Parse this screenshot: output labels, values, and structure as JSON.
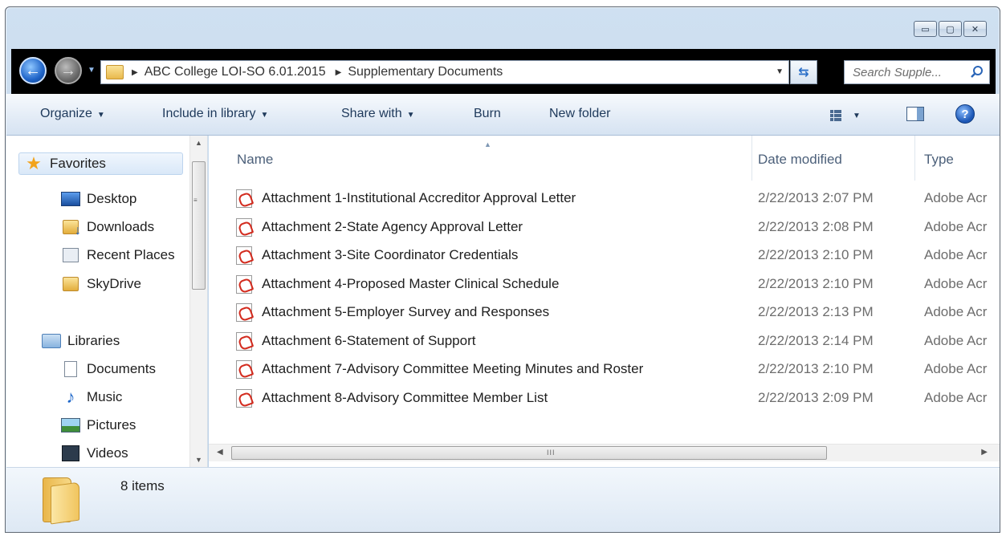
{
  "window": {
    "caption": {
      "minimize": "▭",
      "maximize": "▢",
      "close": "✕"
    }
  },
  "address": {
    "crumbs": [
      "ABC College LOI-SO 6.01.2015",
      "Supplementary Documents"
    ]
  },
  "search": {
    "placeholder": "Search Supple..."
  },
  "toolbar": {
    "organize": "Organize",
    "include_in_library": "Include in library",
    "share_with": "Share with",
    "burn": "Burn",
    "new_folder": "New folder",
    "help": "?"
  },
  "nav": {
    "favorites": "Favorites",
    "desktop": "Desktop",
    "downloads": "Downloads",
    "recent_places": "Recent Places",
    "skydrive": "SkyDrive",
    "libraries": "Libraries",
    "documents": "Documents",
    "music": "Music",
    "pictures": "Pictures",
    "videos": "Videos"
  },
  "columns": {
    "name": "Name",
    "date": "Date modified",
    "type": "Type"
  },
  "files": [
    {
      "name": "Attachment 1-Institutional Accreditor Approval Letter",
      "date": "2/22/2013 2:07 PM",
      "type": "Adobe Acr"
    },
    {
      "name": "Attachment 2-State Agency Approval Letter",
      "date": "2/22/2013 2:08 PM",
      "type": "Adobe Acr"
    },
    {
      "name": "Attachment 3-Site Coordinator Credentials",
      "date": "2/22/2013 2:10 PM",
      "type": "Adobe Acr"
    },
    {
      "name": "Attachment 4-Proposed Master Clinical Schedule",
      "date": "2/22/2013 2:10 PM",
      "type": "Adobe Acr"
    },
    {
      "name": "Attachment 5-Employer Survey and Responses",
      "date": "2/22/2013 2:13 PM",
      "type": "Adobe Acr"
    },
    {
      "name": "Attachment 6-Statement of Support",
      "date": "2/22/2013 2:14 PM",
      "type": "Adobe Acr"
    },
    {
      "name": "Attachment 7-Advisory Committee Meeting Minutes and Roster",
      "date": "2/22/2013 2:10 PM",
      "type": "Adobe Acr"
    },
    {
      "name": "Attachment 8-Advisory Committee Member List",
      "date": "2/22/2013 2:09 PM",
      "type": "Adobe Acr"
    }
  ],
  "status": {
    "item_count": "8 items"
  },
  "scrollbar": {
    "grip": "III"
  },
  "icons": {
    "back": "back-arrow-icon",
    "forward": "forward-arrow-icon",
    "folder": "folder-icon",
    "pdf": "adobe-pdf-icon",
    "search": "magnifier-icon"
  },
  "colors": {
    "pdf_red": "#d32b1e",
    "link_blue": "#1e395b",
    "nav_band": "#000000"
  }
}
